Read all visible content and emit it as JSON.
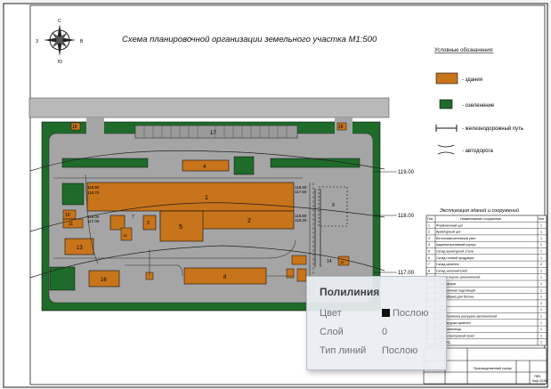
{
  "drawing": {
    "title": "Схема планировочной организации земельного участка М1:500",
    "compass": {
      "north": "С",
      "south": "Ю",
      "west": "З",
      "east": "В"
    },
    "legend": {
      "title": "Условные обозначения:",
      "items": [
        {
          "label": "- здания",
          "color": "#c8741a"
        },
        {
          "label": "- озеленение",
          "color": "#1e6b2a"
        },
        {
          "label": "- железнодорожный путь"
        },
        {
          "label": "- автодорога"
        }
      ]
    },
    "explication": {
      "title": "Экспликация зданий и сооружений",
      "headers": [
        "Поз",
        "Наименование сооружения",
        "Кол"
      ],
      "rows": [
        [
          "1",
          "Формовочный цех",
          "1"
        ],
        [
          "2",
          "Арматурный цех",
          "1"
        ],
        [
          "3",
          "Бетоносмесительный узел",
          "1"
        ],
        [
          "4",
          "Административный корпус",
          "1"
        ],
        [
          "5",
          "Склад арматурной стали",
          "1"
        ],
        [
          "6",
          "Склад готовой продукции",
          "1"
        ],
        [
          "7",
          "Склад цемента",
          "2"
        ],
        [
          "8",
          "Склад заполнителей",
          "1"
        ],
        [
          "",
          "...ерная пороги заполнителей",
          "1"
        ],
        [
          "",
          "...трансформ",
          "1"
        ],
        [
          "",
          "...раздаточная подстанция",
          "1"
        ],
        [
          "",
          "...ая фабрика для бетона",
          "1"
        ],
        [
          "",
          "",
          "1"
        ],
        [
          "",
          "...ьная",
          "1"
        ],
        [
          "",
          "...овая полигона разгрузки заполнителей",
          "1"
        ],
        [
          "",
          "...ат разгрузки цемента",
          "1"
        ],
        [
          "",
          "...внохранилища",
          "1"
        ],
        [
          "",
          "...ьерно-пропускной пункт",
          "1"
        ],
        [
          "",
          "...ой ТЭЦ",
          "1"
        ]
      ]
    },
    "elevations": [
      "118.50",
      "118.70",
      "118.00",
      "117.00",
      "119.00",
      "118.00",
      "117.00",
      "118.50",
      "117.50",
      "118.80",
      "118.20",
      "118.50",
      "118.00"
    ],
    "elev_marks": [
      "119.00",
      "118.00",
      "117.00"
    ],
    "buildings": {
      "b1": "1",
      "b2": "2",
      "b3": "3",
      "b4": "4",
      "b5": "5",
      "b6": "6",
      "b7": "7",
      "b8": "8",
      "b9": "9",
      "b10": "10",
      "b11": "11",
      "b12": "12",
      "b13": "13",
      "b14": "14",
      "b15": "15",
      "b16": "16",
      "b17": "17",
      "b18a": "18",
      "b18b": "18"
    },
    "stamp": {
      "title": "Производственный корпус",
      "sheet": "ПФБ",
      "code": "Каф.СКЗИ"
    }
  },
  "tooltip": {
    "title": "Полилиния",
    "rows": [
      {
        "label": "Цвет",
        "value": "Послою"
      },
      {
        "label": "Слой",
        "value": "0"
      },
      {
        "label": "Тип линий",
        "value": "Послою"
      }
    ]
  }
}
